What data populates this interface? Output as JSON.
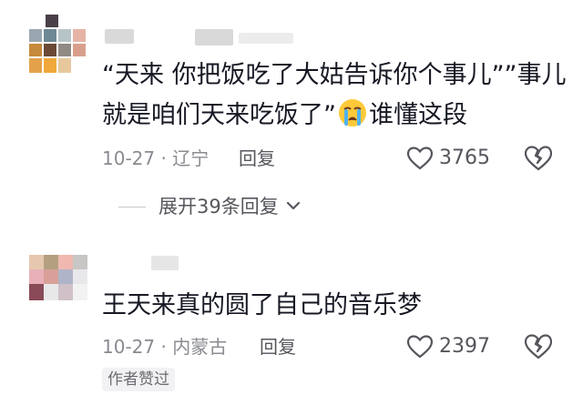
{
  "comments": [
    {
      "text_line1": "“天来 你把饭吃了大姑告诉你个事儿””事儿",
      "text_line2": "就是咱们天来吃饭了”",
      "text_line2_suffix": "谁懂这段",
      "emoji": "crying-face",
      "date": "10-27",
      "location": "辽宁",
      "reply_label": "回复",
      "likes": "3765",
      "expand_label": "展开39条回复"
    },
    {
      "text_line1": "王天来真的圆了自己的音乐梦",
      "date": "10-27",
      "location": "内蒙古",
      "reply_label": "回复",
      "likes": "2397",
      "badge": "作者赞过"
    }
  ],
  "colors": {
    "text": "#161823",
    "meta": "#8a8b91",
    "icon": "#55565c",
    "badge_bg": "#f2f2f4"
  }
}
